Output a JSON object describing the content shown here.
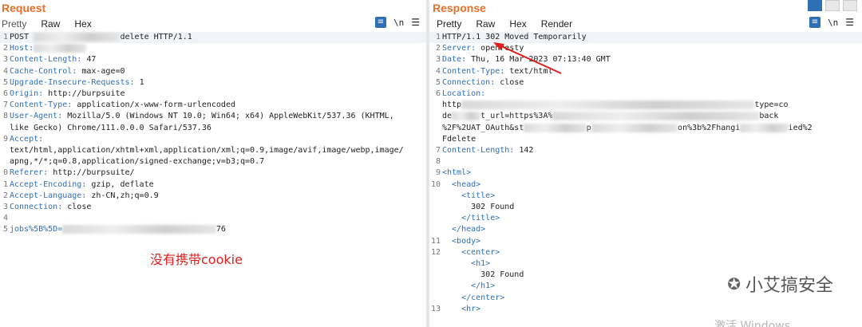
{
  "request": {
    "title": "Request",
    "tabs": [
      "Pretty",
      "Raw",
      "Hex"
    ],
    "active_tab": "Raw",
    "newline_toggle": "\\n",
    "lines": [
      {
        "n": "1",
        "parts": [
          {
            "t": "POST ",
            "c": "plain"
          },
          {
            "t": "                  ",
            "c": "blur"
          },
          {
            "t": "delete HTTP/1.1",
            "c": "plain"
          }
        ]
      },
      {
        "n": "2",
        "parts": [
          {
            "t": "Host:",
            "c": "key"
          },
          {
            "t": "           ",
            "c": "blur"
          }
        ]
      },
      {
        "n": "3",
        "parts": [
          {
            "t": "Content-Length:",
            "c": "key"
          },
          {
            "t": " 47",
            "c": "plain"
          }
        ]
      },
      {
        "n": "4",
        "parts": [
          {
            "t": "Cache-Control:",
            "c": "key"
          },
          {
            "t": " max-age=0",
            "c": "plain"
          }
        ]
      },
      {
        "n": "5",
        "parts": [
          {
            "t": "Upgrade-Insecure-Requests:",
            "c": "key"
          },
          {
            "t": " 1",
            "c": "plain"
          }
        ]
      },
      {
        "n": "6",
        "parts": [
          {
            "t": "Origin:",
            "c": "key"
          },
          {
            "t": " http://burpsuite",
            "c": "plain"
          }
        ]
      },
      {
        "n": "7",
        "parts": [
          {
            "t": "Content-Type:",
            "c": "key"
          },
          {
            "t": " application/x-www-form-urlencoded",
            "c": "plain"
          }
        ]
      },
      {
        "n": "8",
        "parts": [
          {
            "t": "User-Agent:",
            "c": "key"
          },
          {
            "t": " Mozilla/5.0 (Windows NT 10.0; Win64; x64) AppleWebKit/537.36 (KHTML,",
            "c": "plain"
          }
        ]
      },
      {
        "n": "",
        "parts": [
          {
            "t": "like Gecko) Chrome/111.0.0.0 Safari/537.36",
            "c": "plain"
          }
        ]
      },
      {
        "n": "9",
        "parts": [
          {
            "t": "Accept:",
            "c": "key"
          }
        ]
      },
      {
        "n": "",
        "parts": [
          {
            "t": "text/html,application/xhtml+xml,application/xml;q=0.9,image/avif,image/webp,image/",
            "c": "plain"
          }
        ]
      },
      {
        "n": "",
        "parts": [
          {
            "t": "apng,*/*;q=0.8,application/signed-exchange;v=b3;q=0.7",
            "c": "plain"
          }
        ]
      },
      {
        "n": "0",
        "parts": [
          {
            "t": "Referer:",
            "c": "key"
          },
          {
            "t": " http://burpsuite/",
            "c": "plain"
          }
        ]
      },
      {
        "n": "1",
        "parts": [
          {
            "t": "Accept-Encoding:",
            "c": "key"
          },
          {
            "t": " gzip, deflate",
            "c": "plain"
          }
        ]
      },
      {
        "n": "2",
        "parts": [
          {
            "t": "Accept-Language:",
            "c": "key"
          },
          {
            "t": " zh-CN,zh;q=0.9",
            "c": "plain"
          }
        ]
      },
      {
        "n": "3",
        "parts": [
          {
            "t": "Connection:",
            "c": "key"
          },
          {
            "t": " close",
            "c": "plain"
          }
        ]
      },
      {
        "n": "4",
        "parts": []
      },
      {
        "n": "5",
        "parts": [
          {
            "t": "jobs%5B%5D=",
            "c": "key"
          },
          {
            "t": "                                ",
            "c": "blur"
          },
          {
            "t": "76",
            "c": "plain"
          }
        ]
      }
    ]
  },
  "response": {
    "title": "Response",
    "tabs": [
      "Pretty",
      "Raw",
      "Hex",
      "Render"
    ],
    "active_tab": "Pretty",
    "newline_toggle": "\\n",
    "lines": [
      {
        "n": "1",
        "parts": [
          {
            "t": "HTTP/1.1 302 Moved Temporarily",
            "c": "plain"
          }
        ]
      },
      {
        "n": "2",
        "parts": [
          {
            "t": "Server:",
            "c": "key"
          },
          {
            "t": " openresty",
            "c": "plain"
          }
        ]
      },
      {
        "n": "3",
        "parts": [
          {
            "t": "Date:",
            "c": "key"
          },
          {
            "t": " Thu, 16 Mar 2023 07:13:40 GMT",
            "c": "plain"
          }
        ]
      },
      {
        "n": "4",
        "parts": [
          {
            "t": "Content-Type:",
            "c": "key"
          },
          {
            "t": " text/html",
            "c": "plain"
          }
        ]
      },
      {
        "n": "5",
        "parts": [
          {
            "t": "Connection:",
            "c": "key"
          },
          {
            "t": " close",
            "c": "plain"
          }
        ]
      },
      {
        "n": "6",
        "parts": [
          {
            "t": "Location:",
            "c": "key"
          }
        ]
      },
      {
        "n": "",
        "parts": [
          {
            "t": "http",
            "c": "plain"
          },
          {
            "t": "                                                             ",
            "c": "blur"
          },
          {
            "t": "type=co",
            "c": "plain"
          }
        ]
      },
      {
        "n": "",
        "parts": [
          {
            "t": "de",
            "c": "plain"
          },
          {
            "t": "      ",
            "c": "blur"
          },
          {
            "t": "t_url=https%3A%",
            "c": "plain"
          },
          {
            "t": "                                           ",
            "c": "blur"
          },
          {
            "t": "back",
            "c": "plain"
          }
        ]
      },
      {
        "n": "",
        "parts": [
          {
            "t": "%2F%2UAT_OAuth&st",
            "c": "plain"
          },
          {
            "t": "             ",
            "c": "blur"
          },
          {
            "t": "p",
            "c": "plain"
          },
          {
            "t": "                  ",
            "c": "blur"
          },
          {
            "t": "on%3b%2Fhangi",
            "c": "plain"
          },
          {
            "t": "          ",
            "c": "blur"
          },
          {
            "t": "ied%2",
            "c": "plain"
          }
        ]
      },
      {
        "n": "",
        "parts": [
          {
            "t": "Fdelete",
            "c": "plain"
          }
        ]
      },
      {
        "n": "7",
        "parts": [
          {
            "t": "Content-Length:",
            "c": "key"
          },
          {
            "t": " 142",
            "c": "plain"
          }
        ]
      },
      {
        "n": "8",
        "parts": []
      },
      {
        "n": "9",
        "parts": [
          {
            "t": "<html>",
            "c": "tag"
          }
        ]
      },
      {
        "n": "10",
        "parts": [
          {
            "t": "  <head>",
            "c": "tag"
          }
        ]
      },
      {
        "n": "",
        "parts": [
          {
            "t": "    <title>",
            "c": "tag"
          }
        ]
      },
      {
        "n": "",
        "parts": [
          {
            "t": "      302 Found",
            "c": "plain"
          }
        ]
      },
      {
        "n": "",
        "parts": [
          {
            "t": "    </title>",
            "c": "tag"
          }
        ]
      },
      {
        "n": "",
        "parts": [
          {
            "t": "  </head>",
            "c": "tag"
          }
        ]
      },
      {
        "n": "11",
        "parts": [
          {
            "t": "  <body>",
            "c": "tag"
          }
        ]
      },
      {
        "n": "12",
        "parts": [
          {
            "t": "    <center>",
            "c": "tag"
          }
        ]
      },
      {
        "n": "",
        "parts": [
          {
            "t": "      <h1>",
            "c": "tag"
          }
        ]
      },
      {
        "n": "",
        "parts": [
          {
            "t": "        302 Found",
            "c": "plain"
          }
        ]
      },
      {
        "n": "",
        "parts": [
          {
            "t": "      </h1>",
            "c": "tag"
          }
        ]
      },
      {
        "n": "",
        "parts": [
          {
            "t": "    </center>",
            "c": "tag"
          }
        ]
      },
      {
        "n": "13",
        "parts": [
          {
            "t": "    <hr>",
            "c": "tag"
          }
        ]
      }
    ]
  },
  "annotation": "没有携带cookie",
  "watermark": {
    "text": "小艾搞安全",
    "icon": "wechat-icon"
  },
  "os_watermark": "激活 Windows",
  "colors": {
    "accent": "#e8702a",
    "key": "#2f6fb5",
    "annotation": "#e02020"
  }
}
